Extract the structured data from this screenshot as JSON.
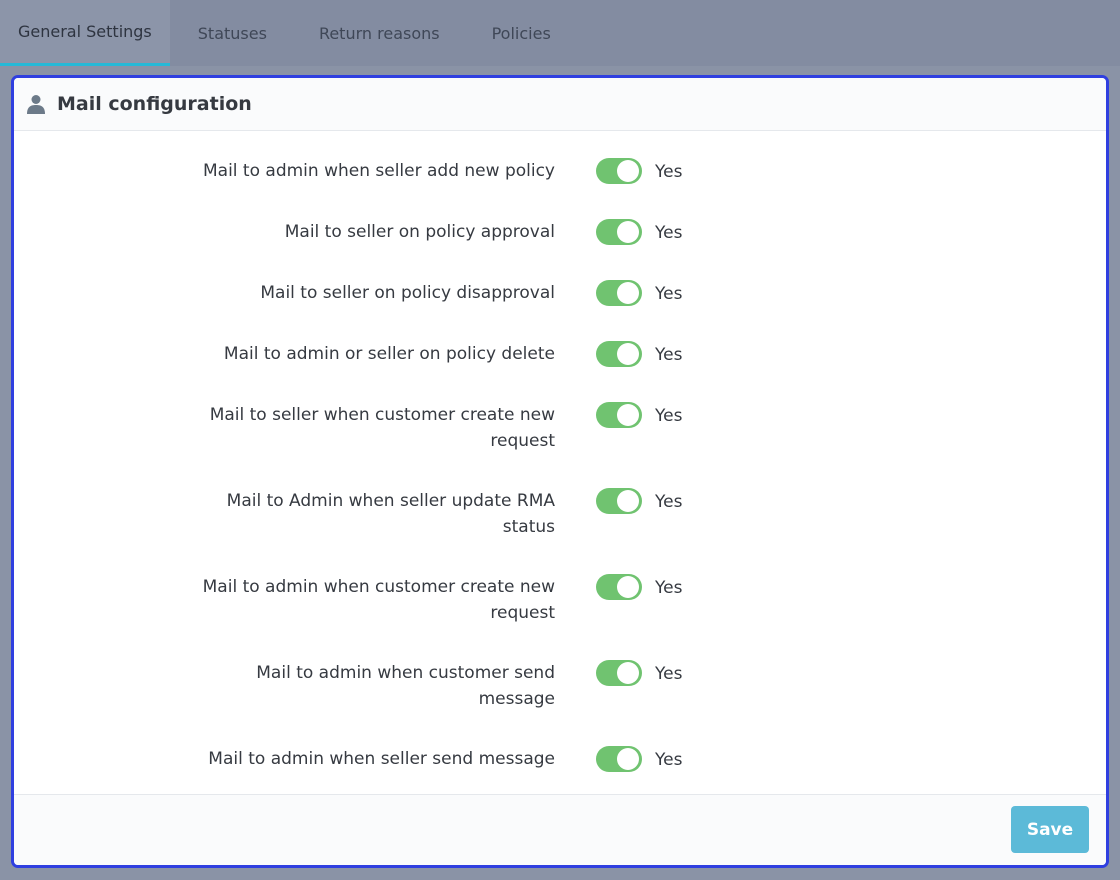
{
  "tabs": [
    {
      "label": "General Settings",
      "active": true
    },
    {
      "label": "Statuses",
      "active": false
    },
    {
      "label": "Return reasons",
      "active": false
    },
    {
      "label": "Policies",
      "active": false
    }
  ],
  "panel": {
    "title": "Mail configuration",
    "icon": "user-icon"
  },
  "settings": [
    {
      "label": "Mail to admin when seller add new policy",
      "value": "Yes",
      "enabled": true
    },
    {
      "label": "Mail to seller on policy approval",
      "value": "Yes",
      "enabled": true
    },
    {
      "label": "Mail to seller on policy disapproval",
      "value": "Yes",
      "enabled": true
    },
    {
      "label": "Mail to admin or seller on policy delete",
      "value": "Yes",
      "enabled": true
    },
    {
      "label": "Mail to seller when customer create new request",
      "value": "Yes",
      "enabled": true
    },
    {
      "label": "Mail to Admin when seller update RMA status",
      "value": "Yes",
      "enabled": true
    },
    {
      "label": "Mail to admin when customer create new request",
      "value": "Yes",
      "enabled": true
    },
    {
      "label": "Mail to admin when customer send message",
      "value": "Yes",
      "enabled": true
    },
    {
      "label": "Mail to admin when seller send message",
      "value": "Yes",
      "enabled": true
    }
  ],
  "footer": {
    "save_label": "Save"
  },
  "colors": {
    "toggle_on": "#70c370",
    "save_button": "#5cbad8",
    "panel_border": "#2f3fe0",
    "tab_active_underline": "#25b9d7"
  }
}
